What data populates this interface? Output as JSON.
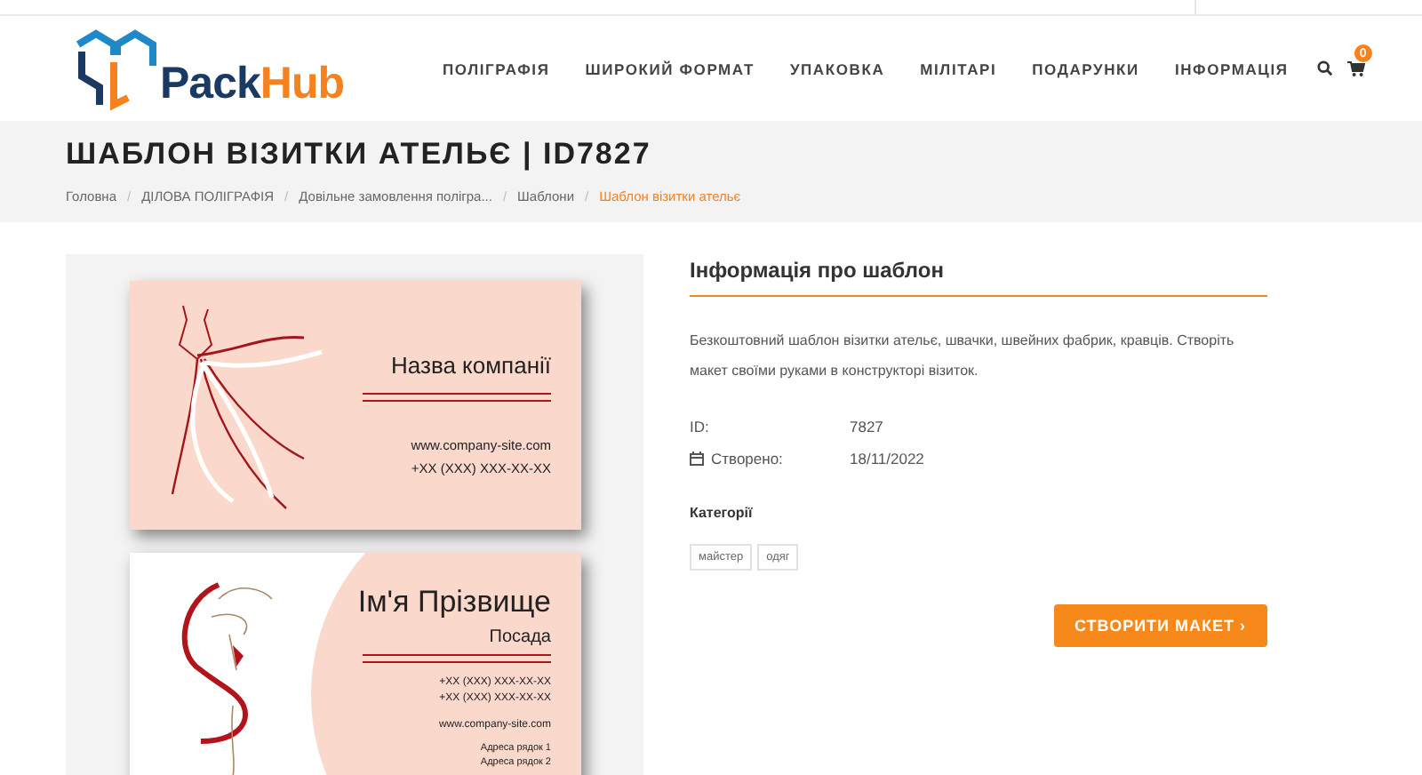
{
  "header": {
    "logo": {
      "part_1": "Pack",
      "part_2": "Hub"
    },
    "nav": [
      {
        "label": "ПОЛІГРАФІЯ"
      },
      {
        "label": "ШИРОКИЙ ФОРМАТ"
      },
      {
        "label": "УПАКОВКА"
      },
      {
        "label": "МІЛІТАРІ"
      },
      {
        "label": "ПОДАРУНКИ"
      },
      {
        "label": "ІНФОРМАЦІЯ"
      }
    ],
    "cart_count": "0"
  },
  "title_band": {
    "title": "ШАБЛОН ВІЗИТКИ АТЕЛЬЄ | ID7827",
    "separator": "/",
    "breadcrumbs": [
      {
        "label": "Головна",
        "current": false
      },
      {
        "label": "ДІЛОВА ПОЛІГРАФІЯ",
        "current": false
      },
      {
        "label": "Довільне замовлення полігра...",
        "current": false
      },
      {
        "label": "Шаблони",
        "current": false
      },
      {
        "label": "Шаблон візитки ательє",
        "current": true
      }
    ]
  },
  "preview": {
    "front": {
      "company": "Назва компанії",
      "website": "www.company-site.com",
      "phone": "+XX (XXX) XXX-XX-XX"
    },
    "back": {
      "name": "Ім'я Прізвище",
      "position": "Посада",
      "phones": [
        "+XX (XXX) XXX-XX-XX",
        "+XX (XXX) XXX-XX-XX"
      ],
      "website": "www.company-site.com",
      "address": [
        "Адреса рядок 1",
        "Адреса рядок 2"
      ]
    }
  },
  "info": {
    "heading": "Інформація про шаблон",
    "description": "Безкоштовний шаблон візитки ательє, швачки, швейних фабрик, кравців. Створіть макет своїми руками в конструкторі візиток.",
    "details": [
      {
        "kind": "plain",
        "label": "ID:",
        "value": "7827"
      },
      {
        "kind": "date",
        "label": "Створено:",
        "value": "18/11/2022"
      }
    ],
    "categories_label": "Категорії",
    "tags": [
      "майстер",
      "одяг"
    ],
    "button": "СТВОРИТИ МАКЕТ ›"
  }
}
